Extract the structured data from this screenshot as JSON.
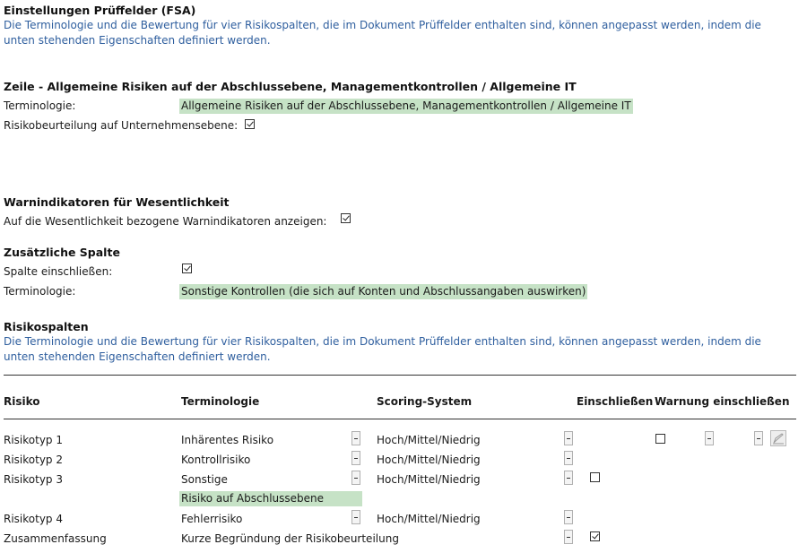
{
  "fsa_settings": {
    "title": "Einstellungen Prüffelder (FSA)",
    "description": "Die Terminologie und die Bewertung für vier Risikospalten, die im Dokument Prüffelder enthalten sind, können angepasst werden, indem die unten stehenden Eigenschaften definiert werden."
  },
  "row_section": {
    "title": "Zeile - Allgemeine Risiken auf der Abschlussebene, Managementkontrollen / Allgemeine IT",
    "terminology_label": "Terminologie:",
    "terminology_value": "Allgemeine Risiken auf der Abschlussebene, Managementkontrollen / Allgemeine IT",
    "entity_level_label": "Risikobeurteilung auf Unternehmensebene:",
    "entity_level_checked": true
  },
  "materiality": {
    "title": "Warnindikatoren für Wesentlichkeit",
    "show_label": "Auf die Wesentlichkeit bezogene Warnindikatoren anzeigen:",
    "show_checked": true
  },
  "additional_column": {
    "title": "Zusätzliche Spalte",
    "include_label": "Spalte einschließen:",
    "include_checked": true,
    "terminology_label": "Terminologie:",
    "terminology_value": "Sonstige Kontrollen (die sich auf Konten und Abschlussangaben auswirken)"
  },
  "risk_columns": {
    "title": "Risikospalten",
    "description": "Die Terminologie und die Bewertung für vier Risikospalten, die im Dokument Prüffelder enthalten sind, können angepasst werden, indem die unten stehenden Eigenschaften definiert werden.",
    "headers": {
      "risk": "Risiko",
      "terminology": "Terminologie",
      "scoring": "Scoring-System",
      "include": "Einschließen",
      "warning": "Warnung einschließen"
    },
    "rows": [
      {
        "risk": "Risikotyp 1",
        "terminology": "Inhärentes Risiko",
        "scoring": "Hoch/Mittel/Niedrig"
      },
      {
        "risk": "Risikotyp 2",
        "terminology": "Kontrollrisiko",
        "scoring": "Hoch/Mittel/Niedrig"
      },
      {
        "risk": "Risikotyp 3",
        "terminology": "Sonstige",
        "scoring": "Hoch/Mittel/Niedrig",
        "sub_value": "Risiko auf Abschlussebene"
      },
      {
        "risk": "Risikotyp 4",
        "terminology": "Fehlerrisiko",
        "scoring": "Hoch/Mittel/Niedrig"
      },
      {
        "risk": "Zusammenfassung",
        "terminology": "Kurze Begründung der Risikobeurteilung"
      }
    ]
  }
}
